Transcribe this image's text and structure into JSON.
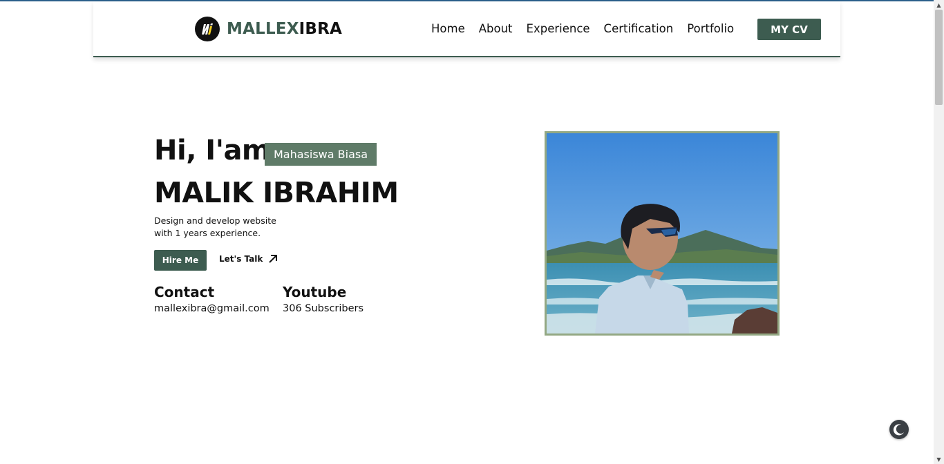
{
  "header": {
    "logo_part1": "MALLEX",
    "logo_part2": "IBRA",
    "nav": [
      "Home",
      "About",
      "Experience",
      "Certification",
      "Portfolio"
    ],
    "cv_label": "MY CV"
  },
  "hero": {
    "greeting": "Hi, I'am",
    "role_badge": "Mahasiswa Biasa",
    "name": "MALIK IBRAHIM",
    "desc_line1": "Design and develop website",
    "desc_line2": "with 1 years experience.",
    "hire_label": "Hire Me",
    "talk_label": "Let's Talk"
  },
  "info": {
    "contact_title": "Contact",
    "contact_value": "mallexibra@gmail.com",
    "youtube_title": "Youtube",
    "youtube_value": "306 Subscribers"
  },
  "icons": {
    "logo": "logo-icon",
    "talk": "arrow-up-right-icon",
    "theme": "moon-icon"
  },
  "colors": {
    "accent": "#3d5c50",
    "badge": "#5f7b68",
    "photo_border": "#93a883"
  }
}
